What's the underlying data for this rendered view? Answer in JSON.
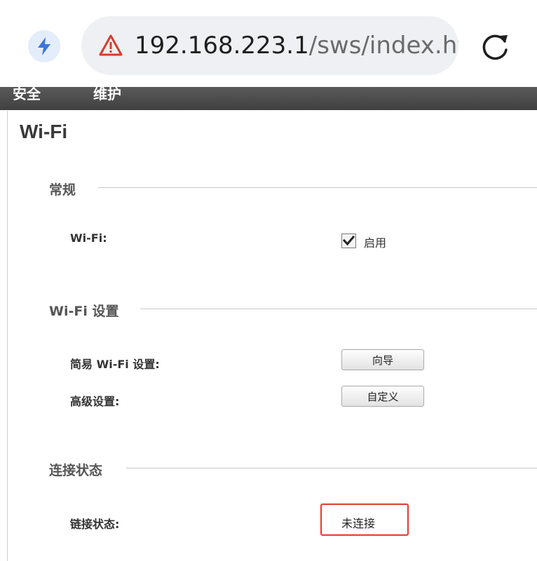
{
  "browser": {
    "url_host": "192.168.223.1",
    "url_path": "/sws/index.htm",
    "icons": {
      "lightning": "lightning-icon",
      "warning": "warning-triangle-icon",
      "reload": "reload-icon"
    },
    "colors": {
      "accent_blue": "#3b76d9",
      "warning_red": "#d93a2c"
    }
  },
  "nav": {
    "items": [
      "安全",
      "维护"
    ]
  },
  "page": {
    "title": "Wi-Fi"
  },
  "sections": {
    "general": {
      "title": "常规",
      "wifi_label": "Wi-Fi:",
      "enable_label": "启用",
      "enable_checked": true
    },
    "wifi_settings": {
      "title": "Wi-Fi 设置",
      "easy_label": "简易 Wi-Fi 设置:",
      "wizard_button": "向导",
      "advanced_label": "高级设置:",
      "custom_button": "自定义"
    },
    "connection": {
      "title": "连接状态",
      "link_label": "链接状态:",
      "link_value": "未连接",
      "highlight_color": "#e03c31"
    }
  }
}
